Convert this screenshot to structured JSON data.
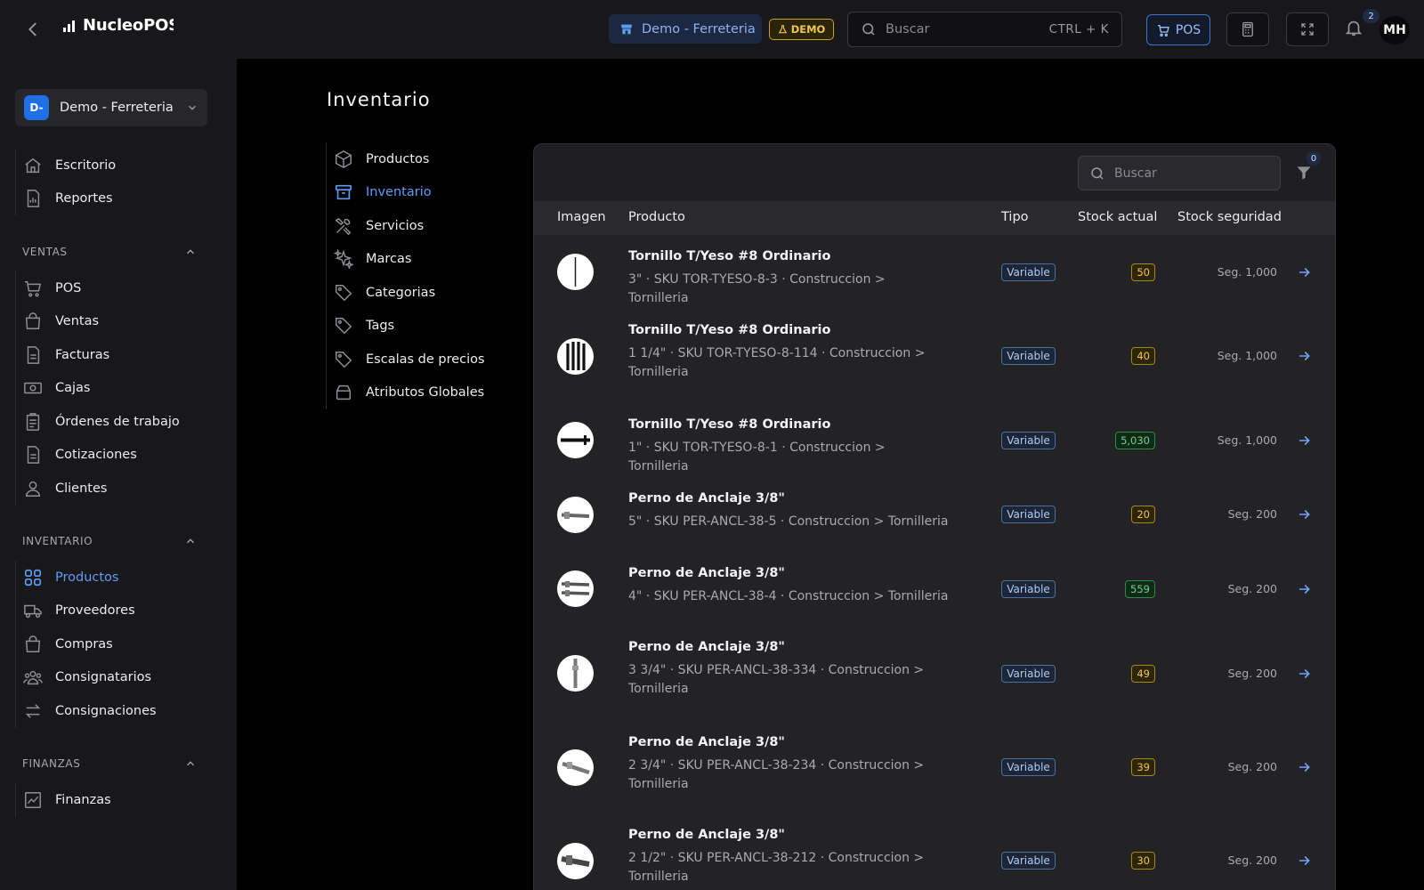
{
  "app": {
    "logo_text": "NucleoPOS"
  },
  "header": {
    "store_name": "Demo - Ferreteria",
    "demo_badge": "DEMO",
    "search_placeholder": "Buscar",
    "search_shortcut": "CTRL + K",
    "pos_label": "POS",
    "notification_count": "2",
    "avatar_initials": "MH"
  },
  "sidebar": {
    "store_badge": "D-",
    "store_name": "Demo - Ferreteria",
    "top_items": [
      {
        "label": "Escritorio",
        "icon": "home-icon"
      },
      {
        "label": "Reportes",
        "icon": "report-icon"
      }
    ],
    "sections": [
      {
        "title": "VENTAS",
        "items": [
          {
            "label": "POS",
            "icon": "cart-icon"
          },
          {
            "label": "Ventas",
            "icon": "bag-icon"
          },
          {
            "label": "Facturas",
            "icon": "document-icon"
          },
          {
            "label": "Cajas",
            "icon": "cash-icon"
          },
          {
            "label": "Órdenes de trabajo",
            "icon": "clipboard-icon"
          },
          {
            "label": "Cotizaciones",
            "icon": "document-icon"
          },
          {
            "label": "Clientes",
            "icon": "user-icon"
          }
        ]
      },
      {
        "title": "INVENTARIO",
        "items": [
          {
            "label": "Productos",
            "icon": "grid-icon",
            "active": true
          },
          {
            "label": "Proveedores",
            "icon": "truck-icon"
          },
          {
            "label": "Compras",
            "icon": "bag-icon"
          },
          {
            "label": "Consignatarios",
            "icon": "users-icon"
          },
          {
            "label": "Consignaciones",
            "icon": "swap-icon"
          }
        ]
      },
      {
        "title": "FINANZAS",
        "items": [
          {
            "label": "Finanzas",
            "icon": "chart-icon"
          }
        ]
      }
    ]
  },
  "main": {
    "title": "Inventario",
    "sub_nav": [
      {
        "label": "Productos",
        "icon": "box-icon"
      },
      {
        "label": "Inventario",
        "icon": "archive-icon",
        "active": true
      },
      {
        "label": "Servicios",
        "icon": "tools-icon"
      },
      {
        "label": "Marcas",
        "icon": "sparkle-icon"
      },
      {
        "label": "Categorias",
        "icon": "tag-icon"
      },
      {
        "label": "Tags",
        "icon": "tag-icon"
      },
      {
        "label": "Escalas de precios",
        "icon": "tag-icon"
      },
      {
        "label": "Atributos Globales",
        "icon": "layers-icon"
      }
    ],
    "table": {
      "search_placeholder": "Buscar",
      "filter_count": "0",
      "columns": [
        "Imagen",
        "Producto",
        "Tipo",
        "Stock actual",
        "Stock seguridad"
      ],
      "rows": [
        {
          "name": "Tornillo T/Yeso #8 Ordinario",
          "meta": "3\" · SKU TOR-TYESO-8-3 · Construccion > Tornilleria",
          "tipo": "Variable",
          "stock": "50",
          "stock_status": "warn",
          "seg": "Seg. 1,000",
          "thumb": "screw-thin"
        },
        {
          "name": "Tornillo T/Yeso #8 Ordinario",
          "meta": "1 1/4\" · SKU TOR-TYESO-8-114 · Construccion > Tornilleria",
          "tipo": "Variable",
          "stock": "40",
          "stock_status": "warn",
          "seg": "Seg. 1,000",
          "thumb": "screw-group"
        },
        {
          "name": "Tornillo T/Yeso #8 Ordinario",
          "meta": "1\" · SKU TOR-TYESO-8-1 · Construccion > Tornilleria",
          "tipo": "Variable",
          "stock": "5,030",
          "stock_status": "ok",
          "seg": "Seg. 1,000",
          "thumb": "screw-side"
        },
        {
          "name": "Perno de Anclaje 3/8\"",
          "meta": "5\" · SKU PER-ANCL-38-5 · Construccion > Tornilleria",
          "tipo": "Variable",
          "stock": "20",
          "stock_status": "warn",
          "seg": "Seg. 200",
          "thumb": "bolt-side"
        },
        {
          "name": "Perno de Anclaje 3/8\"",
          "meta": "4\" · SKU PER-ANCL-38-4 · Construccion > Tornilleria",
          "tipo": "Variable",
          "stock": "559",
          "stock_status": "ok",
          "seg": "Seg. 200",
          "thumb": "bolt-pair"
        },
        {
          "name": "Perno de Anclaje 3/8\"",
          "meta": "3 3/4\" · SKU PER-ANCL-38-334 · Construccion > Tornilleria",
          "tipo": "Variable",
          "stock": "49",
          "stock_status": "warn",
          "seg": "Seg. 200",
          "thumb": "bolt-vertical"
        },
        {
          "name": "Perno de Anclaje 3/8\"",
          "meta": "2 3/4\" · SKU PER-ANCL-38-234 · Construccion > Tornilleria",
          "tipo": "Variable",
          "stock": "39",
          "stock_status": "warn",
          "seg": "Seg. 200",
          "thumb": "bolt-diag"
        },
        {
          "name": "Perno de Anclaje 3/8\"",
          "meta": "2 1/2\" · SKU PER-ANCL-38-212 · Construccion > Tornilleria",
          "tipo": "Variable",
          "stock": "30",
          "stock_status": "warn",
          "seg": "Seg. 200",
          "thumb": "bolt-dark"
        }
      ]
    }
  },
  "colors": {
    "accent": "#5f9bf5",
    "warn": "#f0c64a",
    "ok": "#6fd38d",
    "sidebar_bg": "#18181b",
    "content_bg": "#000000"
  }
}
